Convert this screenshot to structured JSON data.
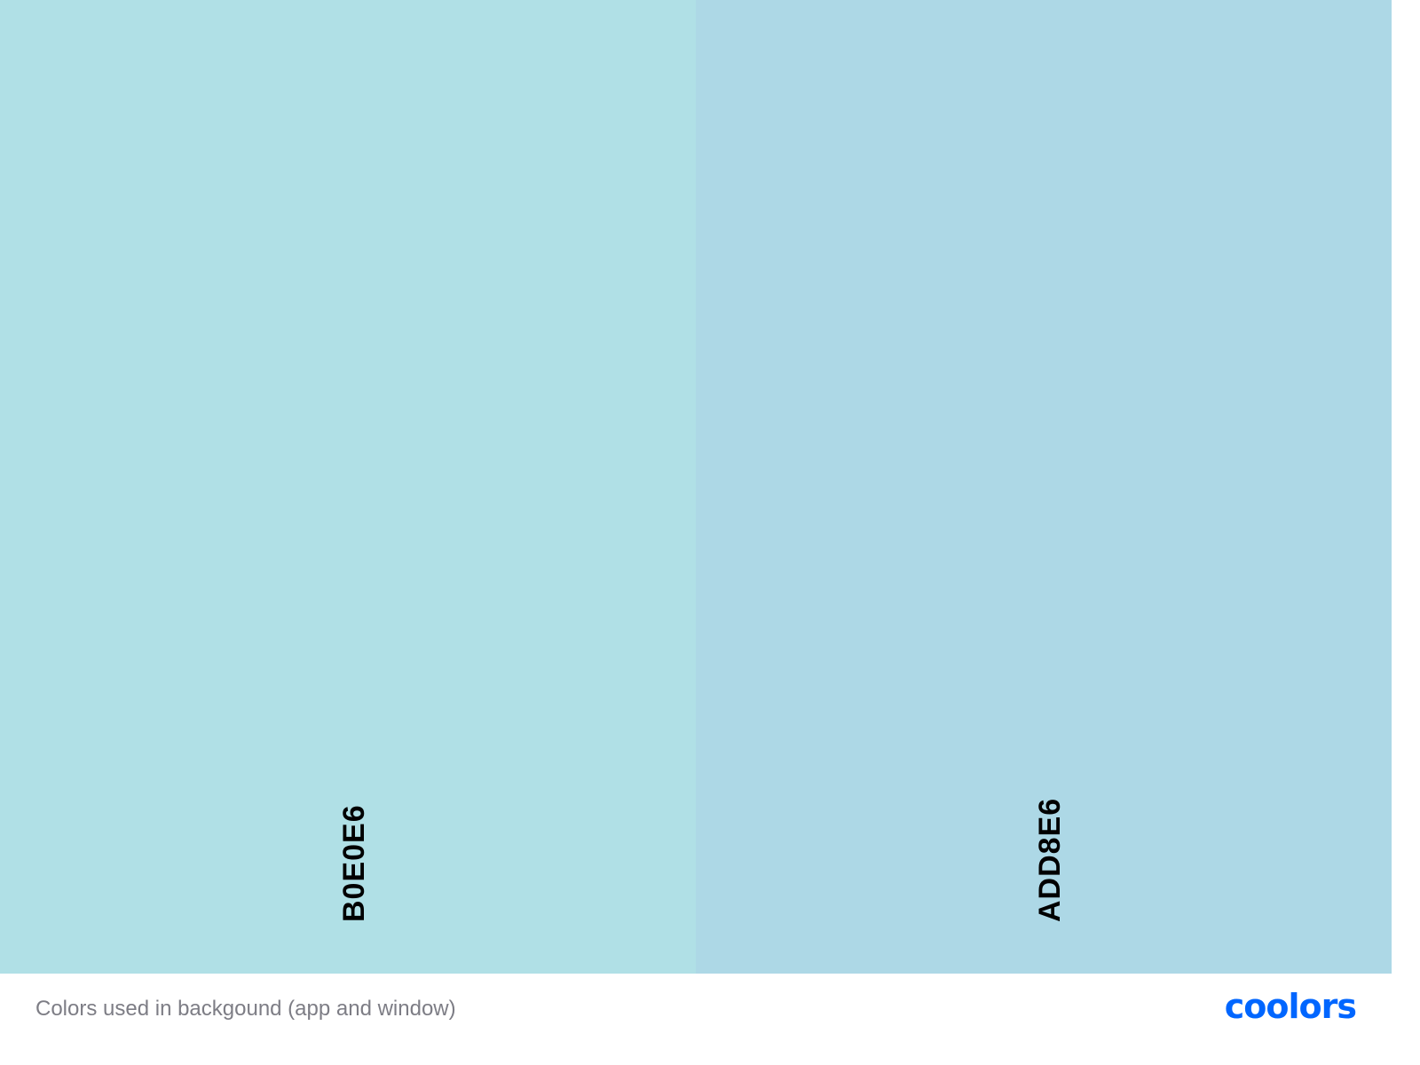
{
  "palette": {
    "swatches": [
      {
        "hex": "B0E0E6",
        "color": "#B0E0E6"
      },
      {
        "hex": "ADD8E6",
        "color": "#ADD8E6"
      }
    ]
  },
  "footer": {
    "caption": "Colors used in backgound (app and window)",
    "logo_text": "coolors",
    "logo_color": "#0066FF"
  }
}
